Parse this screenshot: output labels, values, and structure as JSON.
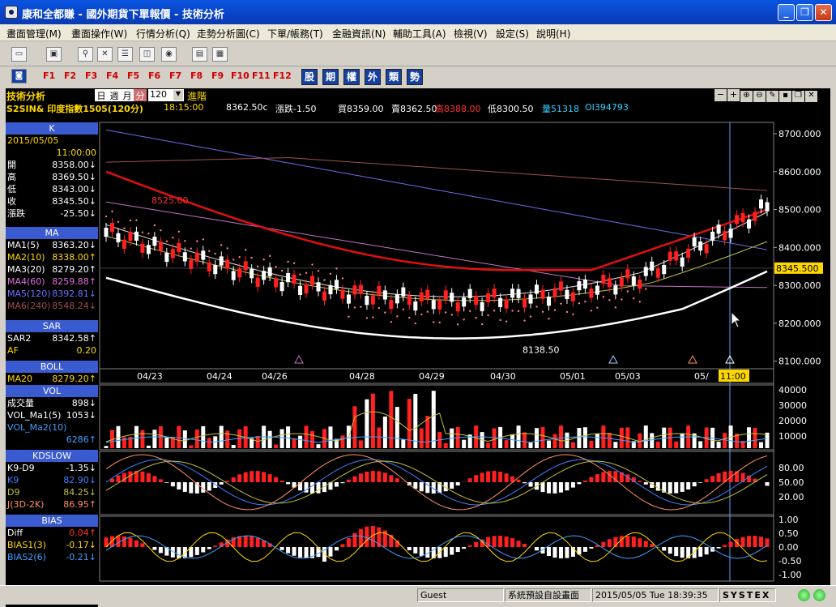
{
  "window": {
    "title": "康和全都賺 - 國外期貨下單報價 - 技術分析"
  },
  "menu": [
    "畫面管理(M)",
    "畫面操作(W)",
    "行情分析(Q)",
    "走勢分析圖(C)",
    "下單/帳務(T)",
    "金融資訊(N)",
    "輔助工具(A)",
    "檢視(V)",
    "設定(S)",
    "說明(H)"
  ],
  "fkeys": [
    "F1",
    "F2",
    "F3",
    "F4",
    "F5",
    "F6",
    "F7",
    "F8",
    "F9",
    "F10",
    "F11",
    "F12"
  ],
  "quick": [
    "股",
    "期",
    "權",
    "外",
    "類",
    "勢"
  ],
  "header": {
    "title": "技術分析",
    "periods": [
      "日",
      "週",
      "月",
      "分"
    ],
    "period_value": "120",
    "advanced": "進階"
  },
  "quote": {
    "symbol": "S2SIN& 印度指數1505(120分)",
    "time": "18:15:00",
    "last": "8362.50c",
    "change": "漲跌-1.50",
    "bid": "買8359.00",
    "ask": "賣8362.50",
    "high": "高8388.00",
    "low": "低8300.50",
    "vol": "量51318",
    "oi": "OI394793"
  },
  "left": {
    "k": {
      "label": "K",
      "date": "2015/05/05",
      "time": "11:00:00",
      "rows": [
        [
          "開",
          "8358.00↓"
        ],
        [
          "高",
          "8369.50↓"
        ],
        [
          "低",
          "8343.00↓"
        ],
        [
          "收",
          "8345.50↓"
        ],
        [
          "漲跌",
          "-25.50↓"
        ]
      ]
    },
    "ma": {
      "label": "MA",
      "rows": [
        [
          "MA1(5)",
          "8363.20↓"
        ],
        [
          "MA2(10)",
          "8338.00↑"
        ],
        [
          "MA3(20)",
          "8279.20↑"
        ],
        [
          "MA4(60)",
          "8259.88↑"
        ],
        [
          "MA5(120)",
          "8392.81↓"
        ],
        [
          "MA6(240)",
          "8548.24↓"
        ]
      ]
    },
    "sar": {
      "label": "SAR",
      "rows": [
        [
          "SAR2",
          "8342.58↑"
        ],
        [
          "AF",
          "0.20"
        ]
      ]
    },
    "boll": {
      "label": "BOLL",
      "rows": [
        [
          "MA20",
          "8279.20↑"
        ]
      ]
    },
    "vol": {
      "label": "VOL",
      "rows": [
        [
          "成交量",
          "898↓"
        ],
        [
          "VOL_Ma1(5)",
          "1053↓"
        ],
        [
          "VOL_Ma2(10)",
          ""
        ],
        [
          "",
          "6286↑"
        ]
      ]
    },
    "kd": {
      "label": "KDSLOW",
      "rows": [
        [
          "K9-D9",
          "-1.35↓"
        ],
        [
          "K9",
          "82.90↓"
        ],
        [
          "D9",
          "84.25↓"
        ],
        [
          "J(3D-2K)",
          "86.95↑"
        ]
      ]
    },
    "bias": {
      "label": "BIAS",
      "rows": [
        [
          "Diff",
          "0.04↑"
        ],
        [
          "BIAS1(3)",
          "-0.17↓"
        ],
        [
          "BIAS2(6)",
          "-0.21↓"
        ]
      ]
    }
  },
  "chart": {
    "price_ticks": [
      "8700.000",
      "8600.000",
      "8500.000",
      "8400.000",
      "8345.500",
      "8300.000",
      "8200.000",
      "8100.000"
    ],
    "dates": [
      "04/23",
      "04/24",
      "04/26",
      "04/28",
      "04/29",
      "04/30",
      "05/01",
      "05/03",
      "05/",
      "11:00"
    ],
    "hi_label": "8525.00",
    "lo_label": "8138.50",
    "vol_ticks": [
      "40000",
      "30000",
      "20000",
      "10000"
    ],
    "kd_ticks": [
      "80.00",
      "50.00",
      "20.00"
    ],
    "bias_ticks": [
      "1.00",
      "0.50",
      "0.00",
      "-0.50",
      "-1.00"
    ]
  },
  "status": {
    "user": "Guest",
    "layout": "系統預設自設畫面",
    "datetime": "2015/05/05 Tue 18:39:35",
    "brand": "SYSTEX"
  },
  "colors": {
    "up": "#ff2020",
    "down": "#ffffff",
    "ma_red": "#e01010",
    "ma5": "#6a6ae8",
    "ma6": "#a05050",
    "accent": "#ffd700"
  }
}
